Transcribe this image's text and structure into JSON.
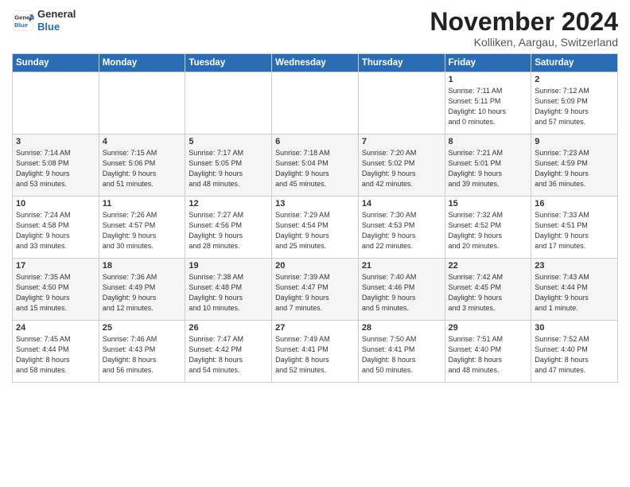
{
  "logo": {
    "line1": "General",
    "line2": "Blue"
  },
  "title": "November 2024",
  "subtitle": "Kolliken, Aargau, Switzerland",
  "days_of_week": [
    "Sunday",
    "Monday",
    "Tuesday",
    "Wednesday",
    "Thursday",
    "Friday",
    "Saturday"
  ],
  "weeks": [
    [
      {
        "day": "",
        "info": ""
      },
      {
        "day": "",
        "info": ""
      },
      {
        "day": "",
        "info": ""
      },
      {
        "day": "",
        "info": ""
      },
      {
        "day": "",
        "info": ""
      },
      {
        "day": "1",
        "info": "Sunrise: 7:11 AM\nSunset: 5:11 PM\nDaylight: 10 hours and 0 minutes."
      },
      {
        "day": "2",
        "info": "Sunrise: 7:12 AM\nSunset: 5:09 PM\nDaylight: 9 hours and 57 minutes."
      }
    ],
    [
      {
        "day": "3",
        "info": "Sunrise: 7:14 AM\nSunset: 5:08 PM\nDaylight: 9 hours and 53 minutes."
      },
      {
        "day": "4",
        "info": "Sunrise: 7:15 AM\nSunset: 5:06 PM\nDaylight: 9 hours and 51 minutes."
      },
      {
        "day": "5",
        "info": "Sunrise: 7:17 AM\nSunset: 5:05 PM\nDaylight: 9 hours and 48 minutes."
      },
      {
        "day": "6",
        "info": "Sunrise: 7:18 AM\nSunset: 5:04 PM\nDaylight: 9 hours and 45 minutes."
      },
      {
        "day": "7",
        "info": "Sunrise: 7:20 AM\nSunset: 5:02 PM\nDaylight: 9 hours and 42 minutes."
      },
      {
        "day": "8",
        "info": "Sunrise: 7:21 AM\nSunset: 5:01 PM\nDaylight: 9 hours and 39 minutes."
      },
      {
        "day": "9",
        "info": "Sunrise: 7:23 AM\nSunset: 4:59 PM\nDaylight: 9 hours and 36 minutes."
      }
    ],
    [
      {
        "day": "10",
        "info": "Sunrise: 7:24 AM\nSunset: 4:58 PM\nDaylight: 9 hours and 33 minutes."
      },
      {
        "day": "11",
        "info": "Sunrise: 7:26 AM\nSunset: 4:57 PM\nDaylight: 9 hours and 30 minutes."
      },
      {
        "day": "12",
        "info": "Sunrise: 7:27 AM\nSunset: 4:56 PM\nDaylight: 9 hours and 28 minutes."
      },
      {
        "day": "13",
        "info": "Sunrise: 7:29 AM\nSunset: 4:54 PM\nDaylight: 9 hours and 25 minutes."
      },
      {
        "day": "14",
        "info": "Sunrise: 7:30 AM\nSunset: 4:53 PM\nDaylight: 9 hours and 22 minutes."
      },
      {
        "day": "15",
        "info": "Sunrise: 7:32 AM\nSunset: 4:52 PM\nDaylight: 9 hours and 20 minutes."
      },
      {
        "day": "16",
        "info": "Sunrise: 7:33 AM\nSunset: 4:51 PM\nDaylight: 9 hours and 17 minutes."
      }
    ],
    [
      {
        "day": "17",
        "info": "Sunrise: 7:35 AM\nSunset: 4:50 PM\nDaylight: 9 hours and 15 minutes."
      },
      {
        "day": "18",
        "info": "Sunrise: 7:36 AM\nSunset: 4:49 PM\nDaylight: 9 hours and 12 minutes."
      },
      {
        "day": "19",
        "info": "Sunrise: 7:38 AM\nSunset: 4:48 PM\nDaylight: 9 hours and 10 minutes."
      },
      {
        "day": "20",
        "info": "Sunrise: 7:39 AM\nSunset: 4:47 PM\nDaylight: 9 hours and 7 minutes."
      },
      {
        "day": "21",
        "info": "Sunrise: 7:40 AM\nSunset: 4:46 PM\nDaylight: 9 hours and 5 minutes."
      },
      {
        "day": "22",
        "info": "Sunrise: 7:42 AM\nSunset: 4:45 PM\nDaylight: 9 hours and 3 minutes."
      },
      {
        "day": "23",
        "info": "Sunrise: 7:43 AM\nSunset: 4:44 PM\nDaylight: 9 hours and 1 minute."
      }
    ],
    [
      {
        "day": "24",
        "info": "Sunrise: 7:45 AM\nSunset: 4:44 PM\nDaylight: 8 hours and 58 minutes."
      },
      {
        "day": "25",
        "info": "Sunrise: 7:46 AM\nSunset: 4:43 PM\nDaylight: 8 hours and 56 minutes."
      },
      {
        "day": "26",
        "info": "Sunrise: 7:47 AM\nSunset: 4:42 PM\nDaylight: 8 hours and 54 minutes."
      },
      {
        "day": "27",
        "info": "Sunrise: 7:49 AM\nSunset: 4:41 PM\nDaylight: 8 hours and 52 minutes."
      },
      {
        "day": "28",
        "info": "Sunrise: 7:50 AM\nSunset: 4:41 PM\nDaylight: 8 hours and 50 minutes."
      },
      {
        "day": "29",
        "info": "Sunrise: 7:51 AM\nSunset: 4:40 PM\nDaylight: 8 hours and 48 minutes."
      },
      {
        "day": "30",
        "info": "Sunrise: 7:52 AM\nSunset: 4:40 PM\nDaylight: 8 hours and 47 minutes."
      }
    ]
  ]
}
